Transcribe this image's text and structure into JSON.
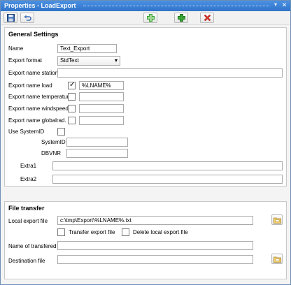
{
  "window": {
    "title": "Properties - LoadExport",
    "pin_icon": "pin-icon",
    "close_icon": "close-icon"
  },
  "toolbar": {
    "icons": [
      "save-icon",
      "undo-icon",
      "add-green-icon",
      "add-icon",
      "delete-icon"
    ]
  },
  "general": {
    "title": "General Settings",
    "name_label": "Name",
    "name_value": "Text_Export",
    "format_label": "Export format",
    "format_value": "StdText",
    "station_label": "Export name station",
    "station_value": "",
    "load_label": "Export name load",
    "load_checked": true,
    "load_value": "%LNAME%",
    "temperature_label": "Export name  temperature",
    "temperature_checked": false,
    "temperature_value": "",
    "windspeed_label": "Export name windspeed",
    "windspeed_checked": false,
    "windspeed_value": "",
    "globalrad_label": "Export name globalrad.",
    "globalrad_checked": false,
    "globalrad_value": "",
    "systemid_use_label": "Use SystemID",
    "systemid_use_checked": false,
    "systemid_label": "SystemID",
    "systemid_value": "",
    "dbvnr_label": "DBVNR",
    "dbvnr_value": "",
    "extra1_label": "Extra1",
    "extra1_value": "",
    "extra2_label": "Extra2",
    "extra2_value": ""
  },
  "transfer": {
    "title": "File transfer",
    "local_label": "Local export file",
    "local_value": "c:\\tmp\\Export\\%LNAME%.txt",
    "transfer_label": "Transfer export file",
    "transfer_checked": false,
    "delete_label": "Delete local export file",
    "delete_checked": false,
    "name_transfered_label": "Name of transfered",
    "name_transfered_value": "",
    "destination_label": "Destination file",
    "destination_value": ""
  },
  "colors": {
    "titlebar": "#2f74c9",
    "add_green": "#3aa335",
    "delete_red": "#d9342b"
  }
}
